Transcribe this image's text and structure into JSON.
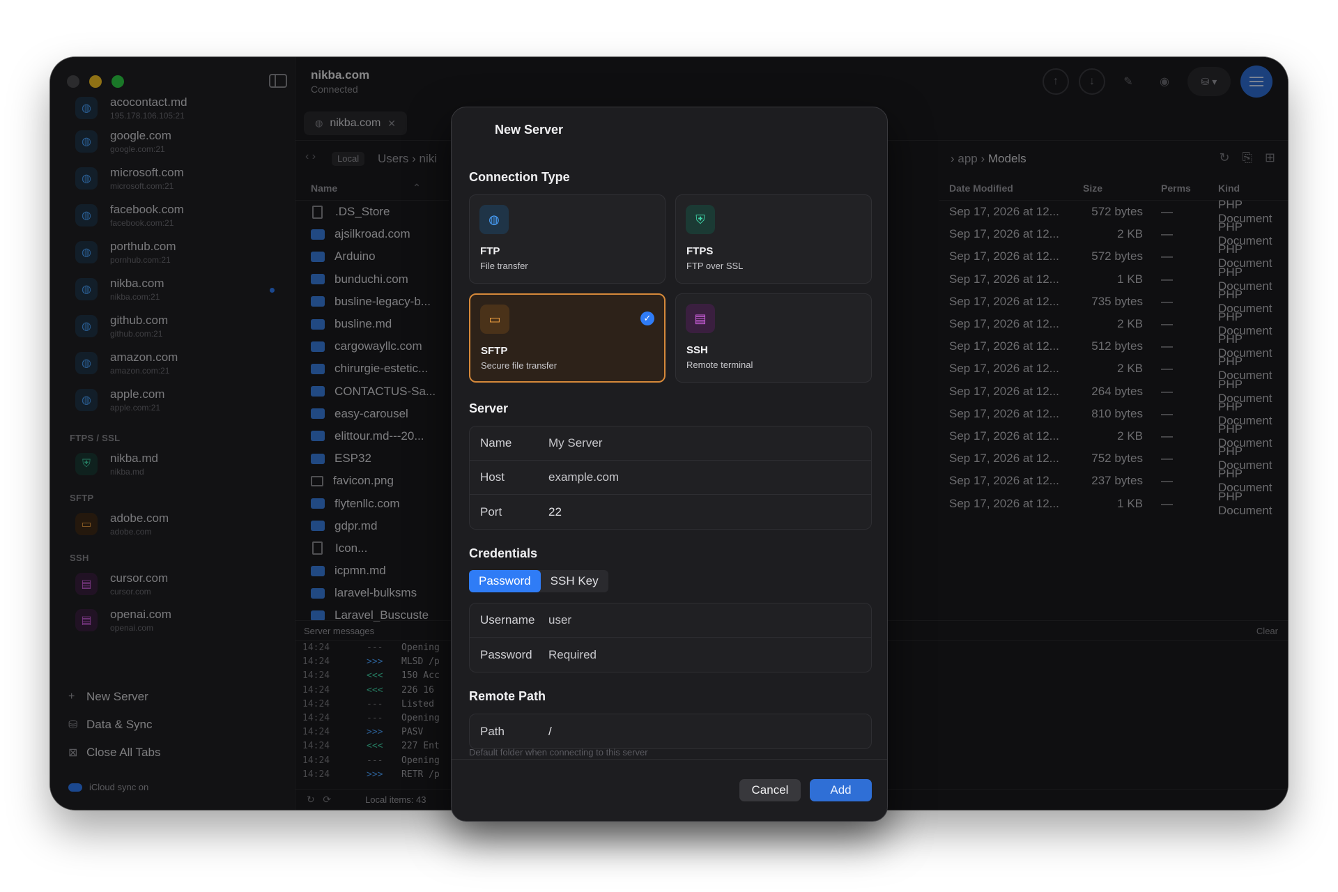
{
  "window": {
    "title": "nikba.com",
    "subtitle": "Connected",
    "traffic_colors": [
      "#4a4a4e",
      "#f7c325",
      "#2ecf46"
    ]
  },
  "sidebar": {
    "top_partial": {
      "name": "acocontact.md",
      "sub": "195.178.106.105:21"
    },
    "servers": [
      {
        "name": "google.com",
        "sub": "google.com:21",
        "icon": "globe-icon"
      },
      {
        "name": "microsoft.com",
        "sub": "microsoft.com:21",
        "icon": "globe-icon"
      },
      {
        "name": "facebook.com",
        "sub": "facebook.com:21",
        "icon": "globe-icon"
      },
      {
        "name": "porthub.com",
        "sub": "pornhub.com:21",
        "icon": "globe-icon"
      },
      {
        "name": "nikba.com",
        "sub": "nikba.com:21",
        "icon": "globe-icon",
        "active": true
      },
      {
        "name": "github.com",
        "sub": "github.com:21",
        "icon": "globe-icon"
      },
      {
        "name": "amazon.com",
        "sub": "amazon.com:21",
        "icon": "globe-icon"
      },
      {
        "name": "apple.com",
        "sub": "apple.com:21",
        "icon": "globe-icon"
      }
    ],
    "sections": [
      {
        "label": "FTPS / SSL",
        "items": [
          {
            "name": "nikba.md",
            "sub": "nikba.md",
            "icon": "shield-icon"
          }
        ]
      },
      {
        "label": "SFTP",
        "items": [
          {
            "name": "adobe.com",
            "sub": "adobe.com",
            "icon": "folder-key-icon"
          }
        ]
      },
      {
        "label": "SSH",
        "items": [
          {
            "name": "cursor.com",
            "sub": "cursor.com",
            "icon": "terminal-icon"
          },
          {
            "name": "openai.com",
            "sub": "openai.com",
            "icon": "terminal-icon"
          }
        ]
      }
    ],
    "actions": {
      "new_server": "New Server",
      "data_sync": "Data & Sync",
      "close_tabs": "Close All Tabs"
    },
    "icloud": "iCloud sync on"
  },
  "tab": {
    "label": "nikba.com"
  },
  "path": {
    "local_pill": "Local",
    "local_crumb": "Users › niki",
    "remote_crumb_1": "app",
    "remote_crumb_2": "Models"
  },
  "local_files": {
    "header": "Name",
    "rows": [
      {
        "name": ".DS_Store",
        "type": "file"
      },
      {
        "name": "ajsilkroad.com",
        "type": "folder"
      },
      {
        "name": "Arduino",
        "type": "folder"
      },
      {
        "name": "bunduchi.com",
        "type": "folder"
      },
      {
        "name": "busline-legacy-b...",
        "type": "folder"
      },
      {
        "name": "busline.md",
        "type": "folder"
      },
      {
        "name": "cargowayllc.com",
        "type": "folder"
      },
      {
        "name": "chirurgie-estetic...",
        "type": "folder"
      },
      {
        "name": "CONTACTUS-Sa...",
        "type": "folder"
      },
      {
        "name": "easy-carousel",
        "type": "folder"
      },
      {
        "name": "elittour.md---20...",
        "type": "folder"
      },
      {
        "name": "ESP32",
        "type": "folder"
      },
      {
        "name": "favicon.png",
        "type": "image"
      },
      {
        "name": "flytenllc.com",
        "type": "folder"
      },
      {
        "name": "gdpr.md",
        "type": "folder"
      },
      {
        "name": "Icon...",
        "type": "file"
      },
      {
        "name": "icpmn.md",
        "type": "folder"
      },
      {
        "name": "laravel-bulksms",
        "type": "folder"
      },
      {
        "name": "Laravel_Buscuste",
        "type": "folder"
      }
    ]
  },
  "remote_files": {
    "headers": {
      "date": "Date Modified",
      "size": "Size",
      "perms": "Perms",
      "kind": "Kind"
    },
    "rows": [
      {
        "date": "Sep 17, 2026 at 12...",
        "size": "572 bytes",
        "perms": "—",
        "kind": "PHP Document"
      },
      {
        "date": "Sep 17, 2026 at 12...",
        "size": "2 KB",
        "perms": "—",
        "kind": "PHP Document"
      },
      {
        "date": "Sep 17, 2026 at 12...",
        "size": "572 bytes",
        "perms": "—",
        "kind": "PHP Document"
      },
      {
        "date": "Sep 17, 2026 at 12...",
        "size": "1 KB",
        "perms": "—",
        "kind": "PHP Document"
      },
      {
        "date": "Sep 17, 2026 at 12...",
        "size": "735 bytes",
        "perms": "—",
        "kind": "PHP Document"
      },
      {
        "date": "Sep 17, 2026 at 12...",
        "size": "2 KB",
        "perms": "—",
        "kind": "PHP Document"
      },
      {
        "date": "Sep 17, 2026 at 12...",
        "size": "512 bytes",
        "perms": "—",
        "kind": "PHP Document"
      },
      {
        "date": "Sep 17, 2026 at 12...",
        "size": "2 KB",
        "perms": "—",
        "kind": "PHP Document"
      },
      {
        "date": "Sep 17, 2026 at 12...",
        "size": "264 bytes",
        "perms": "—",
        "kind": "PHP Document"
      },
      {
        "date": "Sep 17, 2026 at 12...",
        "size": "810 bytes",
        "perms": "—",
        "kind": "PHP Document"
      },
      {
        "date": "Sep 17, 2026 at 12...",
        "size": "2 KB",
        "perms": "—",
        "kind": "PHP Document"
      },
      {
        "date": "Sep 17, 2026 at 12...",
        "size": "752 bytes",
        "perms": "—",
        "kind": "PHP Document"
      },
      {
        "date": "Sep 17, 2026 at 12...",
        "size": "237 bytes",
        "perms": "—",
        "kind": "PHP Document"
      },
      {
        "date": "Sep 17, 2026 at 12...",
        "size": "1 KB",
        "perms": "—",
        "kind": "PHP Document"
      }
    ]
  },
  "log": {
    "label": "Server messages",
    "clear": "Clear",
    "lines": [
      {
        "t": "14:24",
        "d": "---",
        "msg": "Opening"
      },
      {
        "t": "14:24",
        "d": ">>>",
        "msg": "MLSD /p"
      },
      {
        "t": "14:24",
        "d": "<<<",
        "msg": "150 Acc"
      },
      {
        "t": "14:24",
        "d": "<<<",
        "msg": "226 16"
      },
      {
        "t": "14:24",
        "d": "---",
        "msg": "Listed"
      },
      {
        "t": "14:24",
        "d": "---",
        "msg": "Opening"
      },
      {
        "t": "14:24",
        "d": ">>>",
        "msg": "PASV"
      },
      {
        "t": "14:24",
        "d": "<<<",
        "msg": "227 Ent"
      },
      {
        "t": "14:24",
        "d": "---",
        "msg": "Opening"
      },
      {
        "t": "14:24",
        "d": ">>>",
        "msg": "RETR /p"
      }
    ]
  },
  "status": {
    "local_items": "Local items: 43"
  },
  "modal": {
    "title": "New Server",
    "connection_type_label": "Connection Type",
    "types": [
      {
        "name": "FTP",
        "desc": "File transfer",
        "icon": "globe-icon",
        "color": "#4aa3ff",
        "bg": "#1f3447"
      },
      {
        "name": "FTPS",
        "desc": "FTP over SSL",
        "icon": "shield-icon",
        "color": "#3fd2a6",
        "bg": "#1b3a34"
      },
      {
        "name": "SFTP",
        "desc": "Secure file transfer",
        "icon": "folder-key-icon",
        "color": "#f0a040",
        "bg": "#4a3219",
        "selected": true
      },
      {
        "name": "SSH",
        "desc": "Remote terminal",
        "icon": "terminal-icon",
        "color": "#d060e0",
        "bg": "#3a1f3f"
      }
    ],
    "server_label": "Server",
    "server_fields": [
      {
        "label": "Name",
        "placeholder": "My Server"
      },
      {
        "label": "Host",
        "placeholder": "example.com"
      },
      {
        "label": "Port",
        "value": "22"
      }
    ],
    "credentials_label": "Credentials",
    "cred_tabs": [
      {
        "label": "Password",
        "active": true
      },
      {
        "label": "SSH Key"
      }
    ],
    "cred_fields": [
      {
        "label": "Username",
        "placeholder": "user"
      },
      {
        "label": "Password",
        "placeholder": "Required"
      }
    ],
    "remote_path_label": "Remote Path",
    "path_field": {
      "label": "Path",
      "value": "/"
    },
    "path_hint": "Default folder when connecting to this server",
    "cancel": "Cancel",
    "add": "Add",
    "accent": "#2f7cf6",
    "selected_border": "#d6893a"
  }
}
